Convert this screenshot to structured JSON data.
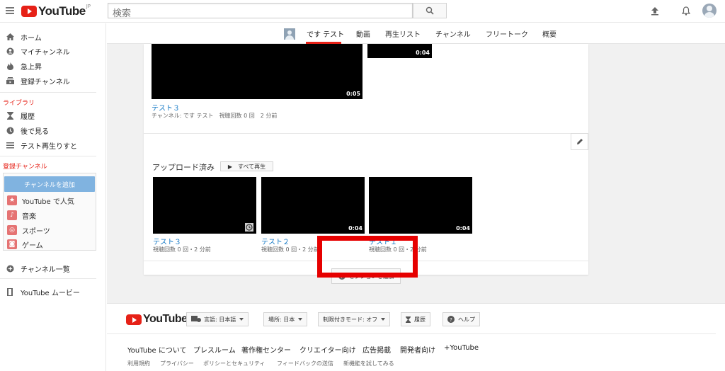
{
  "header": {
    "logo_text": "YouTube",
    "logo_region": "JP",
    "search_placeholder": "検索",
    "brand_color": "#e62117"
  },
  "sidebar": {
    "nav": [
      {
        "label": "ホーム",
        "icon": "home-icon"
      },
      {
        "label": "マイチャンネル",
        "icon": "account-icon"
      },
      {
        "label": "急上昇",
        "icon": "flame-icon"
      },
      {
        "label": "登録チャンネル",
        "icon": "subscriptions-icon"
      }
    ],
    "library_title": "ライブラリ",
    "library": [
      {
        "label": "履歴",
        "icon": "hourglass-icon"
      },
      {
        "label": "後で見る",
        "icon": "clock-icon"
      },
      {
        "label": "テスト再生りすと",
        "icon": "playlist-icon"
      }
    ],
    "subscriptions_title": "登録チャンネル",
    "add_channel_label": "チャンネルを追加",
    "subscriptions": [
      {
        "label": "YouTube で人気",
        "icon": "star-icon"
      },
      {
        "label": "音楽",
        "icon": "music-icon"
      },
      {
        "label": "スポーツ",
        "icon": "sports-icon"
      },
      {
        "label": "ゲーム",
        "icon": "game-icon"
      }
    ],
    "channel_list_label": "チャンネル一覧",
    "movies_label": "YouTube ムービー"
  },
  "channel": {
    "name": "です テスト",
    "tabs": [
      "動画",
      "再生リスト",
      "チャンネル",
      "フリートーク",
      "概要"
    ]
  },
  "content": {
    "top_videos": [
      {
        "title": "テスト３",
        "duration": "0:05",
        "meta": "チャンネル: です テスト　視聴回数 0 回　2 分前"
      },
      {
        "duration": "0:04"
      }
    ],
    "section_title": "アップロード済み",
    "play_all_label": "▶　すべて再生",
    "uploads": [
      {
        "title": "テスト３",
        "duration": "",
        "meta": "視聴回数 0 回・2 分前"
      },
      {
        "title": "テスト２",
        "duration": "0:04",
        "meta": "視聴回数 0 回・2 分前"
      },
      {
        "title": "テスト１",
        "duration": "0:04",
        "meta": "視聴回数 0 回・2 分前"
      }
    ],
    "add_section_label": "セクションを追加",
    "highlight_color": "#e60000"
  },
  "footer": {
    "logo_text": "YouTube",
    "language": "言語: 日本語",
    "location": "場所: 日本",
    "restricted": "制限付きモード: オフ",
    "history": "履歴",
    "help": "ヘルプ",
    "links": [
      "YouTube について",
      "プレスルーム",
      "著作権センター",
      "クリエイター向け",
      "広告掲載",
      "開発者向け",
      "+YouTube"
    ],
    "links2": [
      "利用規約",
      "プライバシー",
      "ポリシーとセキュリティ",
      "フィードバックの送信",
      "新機能を試してみる"
    ]
  }
}
